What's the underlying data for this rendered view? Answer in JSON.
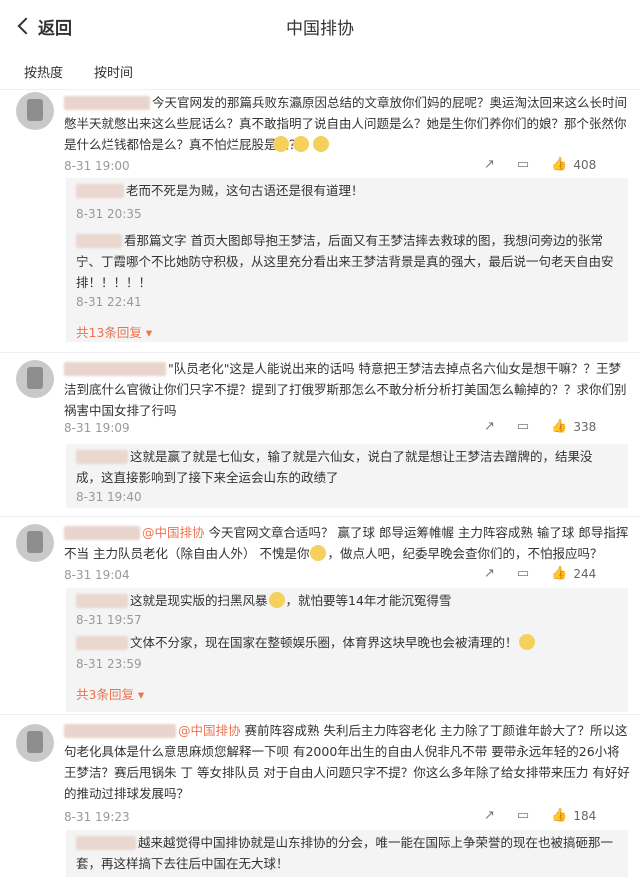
{
  "header": {
    "back_label": "返回",
    "title": "中国排协"
  },
  "sort": {
    "hot": "按热度",
    "time": "按时间"
  },
  "comments": [
    {
      "text": "今天官网发的那篇兵败东瀛原因总结的文章放你们妈的屁呢？奥运淘汰回来这么长时间憋半天就憋出来这么些屁话么？真不敢指明了说自由人问题是么？她是生你们养你们的娘？那个张然你是什么烂钱都恰是么？真不怕烂屁股是么？",
      "time": "8-31 19:00",
      "likes": "408",
      "replies": [
        {
          "text": "老而不死是为贼，这句古语还是很有道理！",
          "time": "8-31 20:35"
        },
        {
          "text": "看那篇文字 首页大图郎导抱王梦洁，后面又有王梦洁摔去救球的图，我想问旁边的张常宁、丁霞哪个不比她防守积极，从这里充分看出来王梦洁背景是真的强大，最后说一句老天自由安排！！！！！",
          "time": "8-31 22:41"
        }
      ],
      "more": "共13条回复"
    },
    {
      "text": "\"队员老化\"这是人能说出来的话吗 特意把王梦洁去掉点名六仙女是想干嘛？？王梦洁到底什么官微让你们只字不提？提到了打俄罗斯那怎么不敢分析分析打美国怎么輸掉的？？求你们别祸害中国女排了行吗",
      "time": "8-31 19:09",
      "likes": "338",
      "replies": [
        {
          "text": "这就是赢了就是七仙女，输了就是六仙女，说白了就是想让王梦洁去蹭牌的，结果没成，这直接影响到了接下来全运会山东的政绩了",
          "time": "8-31 19:40"
        }
      ]
    },
    {
      "tag": "@中国排协",
      "text": "今天官网文章合适吗？ 赢了球 郎导运筹帷幄 主力阵容成熟 输了球 郎导指挥不当 主力队员老化（除自由人外） 不愧是你",
      "text_tail": "，做点人吧，纪委早晚会查你们的，不怕报应吗？",
      "time": "8-31 19:04",
      "likes": "244",
      "replies": [
        {
          "text": "这就是现实版的扫黑风暴",
          "text_tail": "，就怕要等14年才能沉冤得雪",
          "time": "8-31 19:57"
        },
        {
          "text": "文体不分家，现在国家在整顿娱乐圈，体育界这块早晚也会被清理的！",
          "time": "8-31 23:59"
        }
      ],
      "more": "共3条回复"
    },
    {
      "tag": "@中国排协",
      "text": "赛前阵容成熟 失利后主力阵容老化 主力除了丁颜谁年龄大了？所以这句老化具体是什么意思麻烦您解释一下呗 有2000年出生的自由人倪非凡不带 要带永远年轻的26小将王梦洁？赛后甩锅朱 丁 等女排队员 对于自由人问题只字不提？你这么多年除了给女排带来压力 有好好的推动过排球发展吗？",
      "time": "8-31 19:23",
      "likes": "184",
      "replies": [
        {
          "text": "越来越觉得中国排协就是山东排协的分会，唯一能在国际上争荣誉的现在也被搞砸那一套，再这样搞下去往后中国在无大球！"
        }
      ]
    }
  ]
}
